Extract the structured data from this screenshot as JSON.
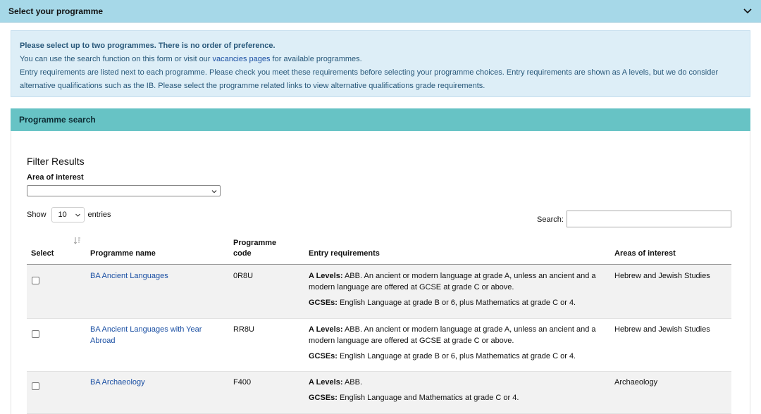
{
  "panel": {
    "title": "Select your programme",
    "chevron_icon": "chevron-down-icon"
  },
  "info": {
    "line1": "Please select up to two programmes. There is no order of preference.",
    "line2_prefix": "You can use the search function on this form or visit our ",
    "line2_link": "vacancies pages",
    "line2_suffix": " for available programmes.",
    "line3": "Entry requirements are listed next to each programme. Please check you meet these requirements before selecting your programme choices. Entry requirements are shown as A levels, but we do consider alternative qualifications such as the IB. Please select the programme related links to view alternative qualifications grade requirements."
  },
  "search_section": {
    "title": "Programme search"
  },
  "filter": {
    "title": "Filter Results",
    "area_label": "Area of interest",
    "area_value": ""
  },
  "length": {
    "show_label": "Show",
    "value": "10",
    "entries_label": "entries"
  },
  "table_search": {
    "label": "Search:",
    "value": ""
  },
  "table": {
    "headers": {
      "select": "Select",
      "name": "Programme name",
      "code_line1": "Programme",
      "code_line2": "code",
      "entry": "Entry requirements",
      "areas": "Areas of interest"
    },
    "rows": [
      {
        "name": "BA Ancient Languages",
        "code": "0R8U",
        "alevel_label": "A Levels:",
        "alevel_text": " ABB. An ancient or modern language at grade A, unless an ancient and a modern language are offered at GCSE at grade C or above.",
        "gcse_label": "GCSEs:",
        "gcse_text": " English Language at grade B or 6, plus Mathematics at grade C or 4.",
        "area": "Hebrew and Jewish Studies",
        "checked": false
      },
      {
        "name": "BA Ancient Languages with Year Abroad",
        "code": "RR8U",
        "alevel_label": "A Levels:",
        "alevel_text": " ABB. An ancient or modern language at grade A, unless an ancient and a modern language are offered at GCSE at grade C or above.",
        "gcse_label": "GCSEs:",
        "gcse_text": " English Language at grade B or 6, plus Mathematics at grade C or 4.",
        "area": "Hebrew and Jewish Studies",
        "checked": false
      },
      {
        "name": "BA Archaeology",
        "code": "F400",
        "alevel_label": "A Levels:",
        "alevel_text": " ABB.",
        "gcse_label": "GCSEs:",
        "gcse_text": " English Language and Mathematics at grade C or 4.",
        "area": "Archaeology",
        "checked": false
      }
    ]
  },
  "colors": {
    "header_bg": "#a6d8e8",
    "info_bg": "#ddeef7",
    "search_bar_bg": "#67c3c5",
    "link": "#1a4fa3"
  }
}
